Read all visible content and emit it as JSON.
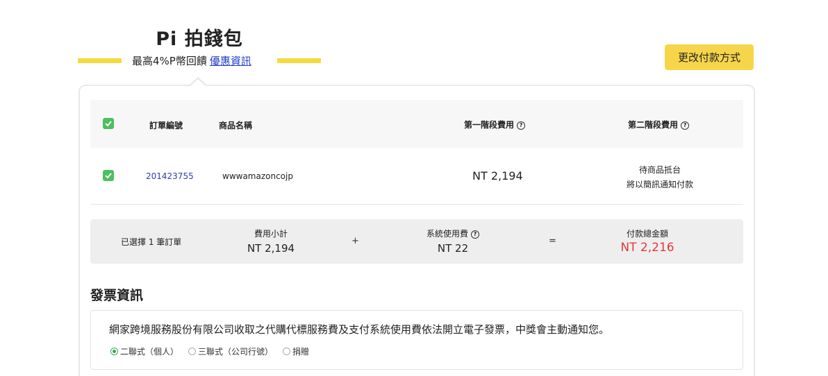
{
  "header": {
    "title": "Pi 拍錢包",
    "subtitle": "最高4%P幣回饋",
    "promo_link": "優惠資訊",
    "accent_color": "#f6d93f"
  },
  "change_payment_button": "更改付款方式",
  "table": {
    "columns": [
      "訂單編號",
      "商品名稱",
      "第一階段費用",
      "第二階段費用"
    ],
    "rows": [
      {
        "checked": true,
        "order_id": "201423755",
        "product": "wwwamazoncojp",
        "stage1_fee": "NT 2,194",
        "stage2_line1": "待商品抵台",
        "stage2_line2": "將以簡訊通知付款"
      }
    ]
  },
  "summary": {
    "selected": "已選擇 1 筆訂單",
    "subtotal_label": "費用小計",
    "subtotal_value": "NT 2,194",
    "plus": "+",
    "system_fee_label": "系統使用費",
    "system_fee_value": "NT 22",
    "equals": "=",
    "total_label": "付款總金額",
    "total_value": "NT 2,216",
    "total_color": "#e03a3a"
  },
  "invoice": {
    "title": "發票資訊",
    "note": "網家跨境服務股份有限公司收取之代購代標服務費及支付系統使用費依法開立電子發票，中獎會主動通知您。",
    "options": [
      {
        "label": "二聯式（個人）",
        "selected": true
      },
      {
        "label": "三聯式（公司行號）",
        "selected": false
      },
      {
        "label": "捐贈",
        "selected": false
      }
    ]
  },
  "icons": {
    "checkbox": "check-icon",
    "help": "question-circle-icon"
  }
}
